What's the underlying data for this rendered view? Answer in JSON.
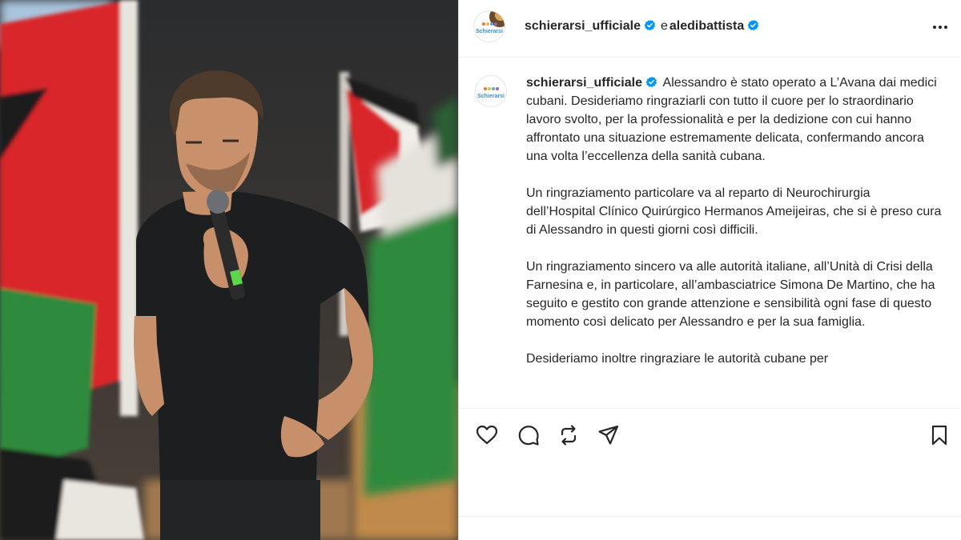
{
  "post": {
    "author": "schierarsi_ufficiale",
    "connector": "e",
    "coauthor": "aledibattista",
    "avatar_label": "Schierarsi",
    "caption_author": "schierarsi_ufficiale",
    "caption_first": "Alessandro è stato operato a L’Avana dai medici cubani. Desideriamo ringraziarli con tutto il cuore per lo straordinario lavoro svolto, per la professionalità e per la dedizione con cui hanno affrontato una situazione estremamente delicata, confermando ancora una volta l’eccellenza della sanità cubana.",
    "paragraphs": [
      "Un ringraziamento particolare va al reparto di Neurochirurgia dell’Hospital Clínico Quirúrgico Hermanos Ameijeiras, che si è preso cura di Alessandro in questi giorni così difficili.",
      "Un ringraziamento sincero va alle autorità italiane, all’Unità di Crisi della Farnesina e, in particolare, all’ambasciatrice Simona De Martino, che ha seguito e gestito con grande attenzione e sensibilità ogni fase di questo momento così delicato per Alessandro e per la sua famiglia.",
      "Desideriamo inoltre ringraziare le autorità cubane per"
    ]
  },
  "icons": {
    "verified": "verified-badge-icon",
    "more": "more-options-icon",
    "like": "heart-icon",
    "comment": "comment-icon",
    "repost": "repost-icon",
    "share": "share-icon",
    "save": "bookmark-icon"
  },
  "colors": {
    "verified": "#0095f6",
    "text": "#262626",
    "border": "#efefef",
    "flag_red": "#d8262b",
    "flag_green": "#2f8a3c"
  }
}
